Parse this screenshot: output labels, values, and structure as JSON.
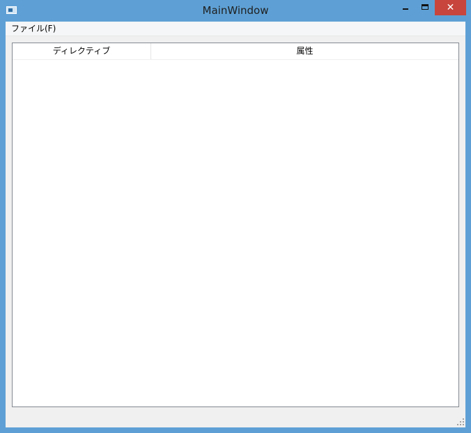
{
  "window": {
    "title": "MainWindow",
    "close_glyph": "✕"
  },
  "menubar": {
    "items": [
      {
        "label": "ファイル(F)"
      }
    ]
  },
  "table": {
    "columns": [
      {
        "label": "ディレクティブ"
      },
      {
        "label": "属性"
      }
    ],
    "rows": []
  },
  "colors": {
    "titlebar": "#5ea0d5",
    "close_button": "#c7453c",
    "client_background": "#f0f0f0",
    "table_border": "#828790"
  },
  "icons": {
    "app": "app-icon",
    "minimize": "minimize-icon",
    "maximize": "maximize-icon",
    "close": "close-icon",
    "resize_grip": "resize-grip-icon"
  }
}
